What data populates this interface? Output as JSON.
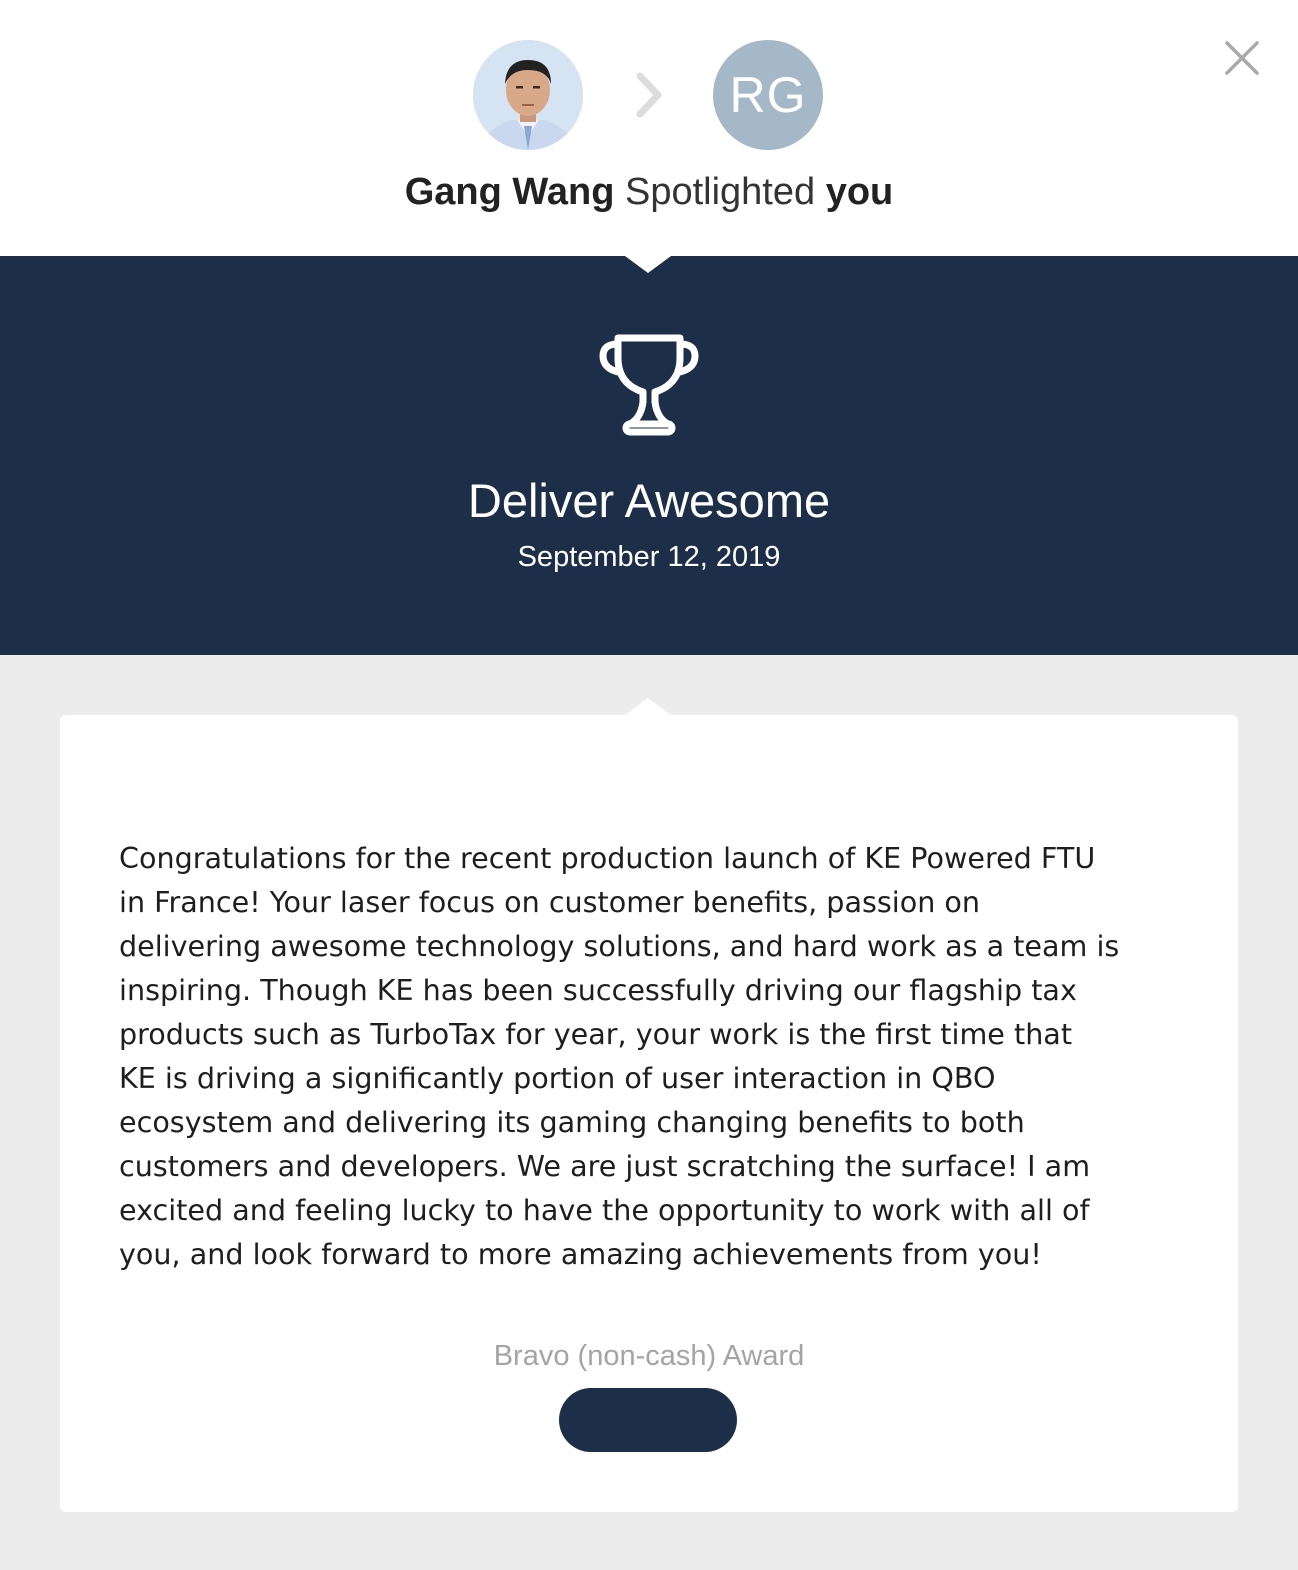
{
  "sender": {
    "name": "Gang Wang",
    "avatar": "photo"
  },
  "recipient": {
    "initials": "RG",
    "label": "you",
    "avatar_color": "#a5b8c7"
  },
  "headline": {
    "action": "Spotlighted"
  },
  "award": {
    "icon": "trophy-icon",
    "title": "Deliver Awesome",
    "date": "September 12, 2019",
    "band_color": "#1d2f48"
  },
  "message": "Congratulations for the recent production launch of KE Powered FTU\nin France! Your laser focus on customer benefits, passion on\ndelivering awesome technology solutions, and hard work as a team is\ninspiring. Though KE has been successfully driving our flagship tax\nproducts such as TurboTax for year, your work is the first time that\nKE is driving a significantly portion of user interaction in QBO\necosystem and delivering its gaming changing benefits to both\ncustomers and developers. We are just scratching the surface! I am\nexcited and feeling lucky to have the opportunity to work with all of\nyou, and look forward to more amazing achievements from you!",
  "reward": {
    "type": "Bravo (non-cash) Award",
    "button_label": ""
  },
  "controls": {
    "close_icon": "close-icon",
    "arrow_icon": "chevron-right-icon"
  }
}
